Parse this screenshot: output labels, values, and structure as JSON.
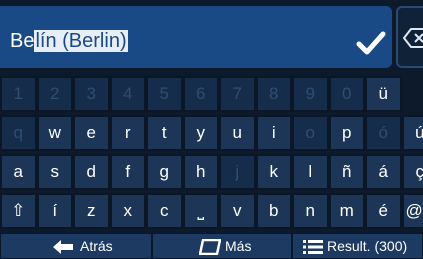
{
  "search": {
    "text_prefix": "Be",
    "text_selected": "lín (Berlin)"
  },
  "keyboard": {
    "rows": [
      [
        {
          "label": "1",
          "enabled": false
        },
        {
          "label": "2",
          "enabled": false
        },
        {
          "label": "3",
          "enabled": false
        },
        {
          "label": "4",
          "enabled": false
        },
        {
          "label": "5",
          "enabled": false
        },
        {
          "label": "6",
          "enabled": false
        },
        {
          "label": "7",
          "enabled": false
        },
        {
          "label": "8",
          "enabled": false
        },
        {
          "label": "9",
          "enabled": false
        },
        {
          "label": "0",
          "enabled": false
        },
        {
          "label": "ü",
          "enabled": true
        }
      ],
      [
        {
          "label": "q",
          "enabled": false
        },
        {
          "label": "w",
          "enabled": true
        },
        {
          "label": "e",
          "enabled": true
        },
        {
          "label": "r",
          "enabled": true
        },
        {
          "label": "t",
          "enabled": true
        },
        {
          "label": "y",
          "enabled": true
        },
        {
          "label": "u",
          "enabled": true
        },
        {
          "label": "i",
          "enabled": true
        },
        {
          "label": "o",
          "enabled": false
        },
        {
          "label": "p",
          "enabled": true
        },
        {
          "label": "ó",
          "enabled": false
        },
        {
          "label": "ú",
          "enabled": true
        }
      ],
      [
        {
          "label": "a",
          "enabled": true
        },
        {
          "label": "s",
          "enabled": true
        },
        {
          "label": "d",
          "enabled": true
        },
        {
          "label": "f",
          "enabled": true
        },
        {
          "label": "g",
          "enabled": true
        },
        {
          "label": "h",
          "enabled": true
        },
        {
          "label": "j",
          "enabled": false
        },
        {
          "label": "k",
          "enabled": true
        },
        {
          "label": "l",
          "enabled": true
        },
        {
          "label": "ñ",
          "enabled": true
        },
        {
          "label": "á",
          "enabled": true
        },
        {
          "label": "ç",
          "enabled": true
        }
      ],
      [
        {
          "label": "⇧",
          "enabled": true,
          "icon": "shift-icon"
        },
        {
          "label": "í",
          "enabled": true
        },
        {
          "label": "z",
          "enabled": true
        },
        {
          "label": "x",
          "enabled": true
        },
        {
          "label": "c",
          "enabled": true
        },
        {
          "label": "⎵",
          "enabled": true,
          "icon": "space-icon"
        },
        {
          "label": "v",
          "enabled": true
        },
        {
          "label": "b",
          "enabled": true
        },
        {
          "label": "n",
          "enabled": true
        },
        {
          "label": "m",
          "enabled": true
        },
        {
          "label": "é",
          "enabled": true
        },
        {
          "label": "@&",
          "enabled": true
        }
      ]
    ]
  },
  "bottom_bar": {
    "back_label": "Atrás",
    "more_label": "Más",
    "results_label": "Result. (300)"
  },
  "colors": {
    "field_bg": "#1a4a86",
    "key_bg": "#1d3657",
    "key_disabled_text": "#2e4e74",
    "background": "#0c1a2c"
  }
}
